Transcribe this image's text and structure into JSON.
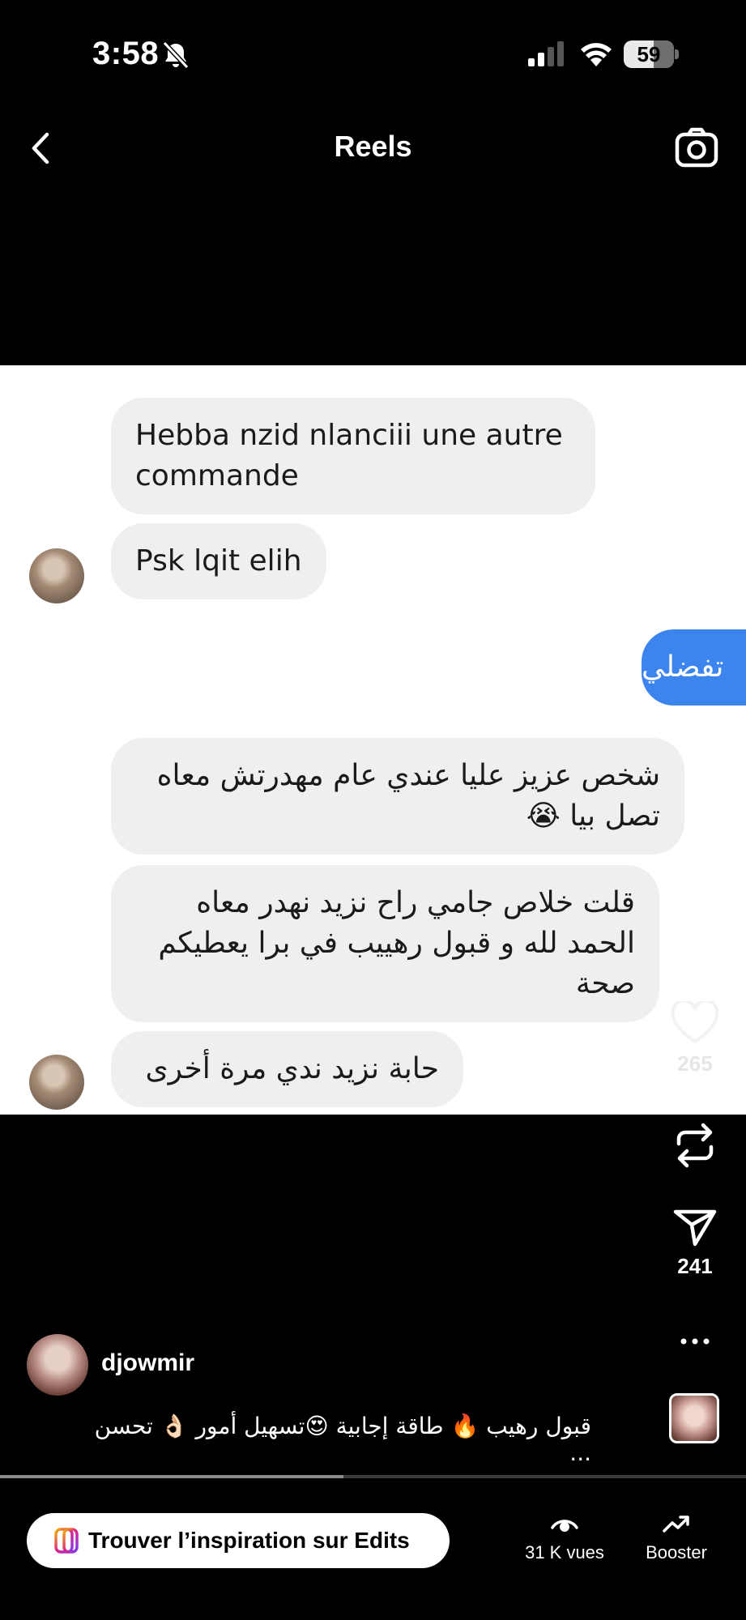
{
  "status_bar": {
    "time": "3:58",
    "battery": "59",
    "battery_level": 0.59
  },
  "header": {
    "title": "Reels"
  },
  "video": {
    "messages": [
      {
        "text": "Hebba nzid nlanciii une autre commande",
        "from": "them"
      },
      {
        "text": "Psk lqit elih",
        "from": "them"
      },
      {
        "text": "تفضلي",
        "from": "me"
      },
      {
        "text": "شخص عزيز عليا عندي عام مهدرتش معاه تصل بيا 😭",
        "from": "them"
      },
      {
        "text": "قلت خلاص جامي راح نزيد نهدر معاه الحمد لله و قبول رهييب في برا يعطيكم صحة",
        "from": "them"
      },
      {
        "text": "حابة نزيد ندي مرة أخرى",
        "from": "them"
      }
    ]
  },
  "actions": {
    "likes": "265",
    "shares": "241"
  },
  "post": {
    "username": "djowmir",
    "caption": "قبول رهيب 🔥 طاقة إجابية 😍تسهيل أمور 👌🏻 تحسن ..."
  },
  "playback": {
    "progress": 0.46
  },
  "bottom": {
    "edits_label": "Trouver l’inspiration sur Edits",
    "views_label": "31 K vues",
    "boost_label": "Booster"
  },
  "colors": {
    "sent_bubble": "#3c84ee",
    "received_bubble": "#efeff1"
  },
  "icons": [
    "bell-muted-icon",
    "signal-icon",
    "wifi-icon",
    "back-chevron-icon",
    "camera-icon",
    "heart-icon",
    "repost-icon",
    "send-icon",
    "more-icon",
    "edits-icon",
    "eye-icon",
    "trend-icon"
  ]
}
